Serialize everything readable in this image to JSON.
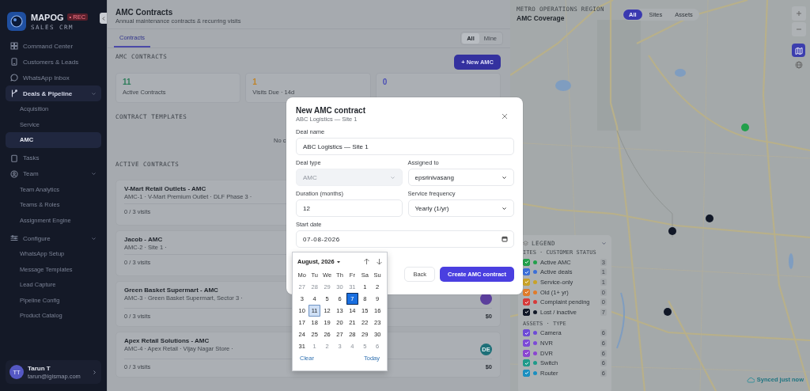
{
  "sidebar": {
    "brand": "MAPOG",
    "badge": "• REC",
    "tagline": "SALES CRM",
    "nav": [
      {
        "label": "Command Center",
        "selected": false
      },
      {
        "label": "Customers & Leads",
        "selected": false
      },
      {
        "label": "WhatsApp Inbox",
        "selected": false
      },
      {
        "label": "Deals & Pipeline",
        "selected": true,
        "expanded": true,
        "children": [
          {
            "label": "Acquisition",
            "selected": false
          },
          {
            "label": "Service",
            "selected": false
          },
          {
            "label": "AMC",
            "selected": true
          }
        ]
      },
      {
        "label": "Tasks",
        "selected": false
      },
      {
        "label": "Team",
        "selected": false,
        "expanded": true,
        "children": [
          {
            "label": "Team Analytics",
            "selected": false
          },
          {
            "label": "Teams & Roles",
            "selected": false
          },
          {
            "label": "Assignment Engine",
            "selected": false
          }
        ]
      },
      {
        "label": "Configure",
        "selected": false,
        "expanded": true,
        "children": [
          {
            "label": "WhatsApp Setup",
            "selected": false
          },
          {
            "label": "Message Templates",
            "selected": false
          },
          {
            "label": "Lead Capture",
            "selected": false
          },
          {
            "label": "Pipeline Config",
            "selected": false
          },
          {
            "label": "Product Catalog",
            "selected": false
          }
        ]
      }
    ],
    "user": {
      "initials": "TT",
      "name": "Tarun T",
      "email": "tarun@igismap.com"
    }
  },
  "page": {
    "title": "AMC Contracts",
    "subtitle": "Annual maintenance contracts & recurring visits",
    "tabs": [
      {
        "label": "Contracts",
        "selected": true
      }
    ],
    "scope": [
      {
        "label": "All",
        "selected": true
      },
      {
        "label": "Mine",
        "selected": false
      }
    ],
    "contracts_label": "AMC CONTRACTS",
    "new_button": "+ New AMC",
    "stats": [
      {
        "value": "11",
        "label": "Active Contracts",
        "color": "#2e7d5b"
      },
      {
        "value": "1",
        "label": "Visits Due · 14d",
        "color": "#c0842a"
      },
      {
        "value": "0",
        "color": "#4b4fb5"
      }
    ],
    "templates_label": "CONTRACT TEMPLATES",
    "templates_empty": "No c",
    "active_label": "ACTIVE CONTRACTS",
    "contracts": [
      {
        "title": "V-Mart Retail Outlets - AMC",
        "detail": "AMC-1 · V-Mart Premium Outlet · DLF Phase 3 ·",
        "visits": "0 / 3 visits"
      },
      {
        "title": "Jacob - AMC",
        "detail": "AMC-2 · Site 1 ·",
        "visits": "0 / 3 visits"
      },
      {
        "title": "Green Basket Supermart - AMC",
        "detail": "AMC-3 · Green Basket Supermart, Sector 3 ·",
        "visits": "0 / 3 visits",
        "amount": "$0",
        "avatar": {
          "color": "#5b3f9c"
        }
      },
      {
        "title": "Apex Retail Solutions - AMC",
        "detail": "AMC-4 · Apex Retail · Vijay Nagar Store ·",
        "visits": "0 / 3 visits",
        "amount": "$0",
        "avatar": {
          "initials": "DE",
          "color": "#1d6f78"
        }
      }
    ]
  },
  "modal": {
    "title": "New AMC contract",
    "subtitle": "ABC Logistics — Site 1",
    "rows": [
      [
        {
          "kind": "text",
          "label": "Deal name",
          "value": "ABC Logistics — Site 1",
          "disabled": false
        }
      ],
      [
        {
          "kind": "select",
          "label": "Deal type",
          "value": "AMC",
          "disabled": true
        },
        {
          "kind": "select",
          "label": "Assigned to",
          "value": "epsrinivasang",
          "disabled": false
        }
      ],
      [
        {
          "kind": "text",
          "label": "Duration (months)",
          "value": "12",
          "disabled": false
        },
        {
          "kind": "select",
          "label": "Service frequency",
          "value": "Yearly (1/yr)",
          "disabled": false
        }
      ],
      [
        {
          "kind": "date",
          "label": "Start date",
          "value": "07-08-2026",
          "disabled": false
        }
      ]
    ],
    "buttons": [
      {
        "label": "Back",
        "kind": "secondary"
      },
      {
        "label": "Create AMC contract",
        "kind": "primary"
      }
    ],
    "calendar": {
      "month": "August, 2026",
      "weekdays": [
        "Mo",
        "Tu",
        "We",
        "Th",
        "Fr",
        "Sa",
        "Su"
      ],
      "weeks": [
        [
          {
            "day": "27",
            "outside": true,
            "selected": false,
            "today": false
          },
          {
            "day": "28",
            "outside": true,
            "selected": false,
            "today": false
          },
          {
            "day": "29",
            "outside": true,
            "selected": false,
            "today": false
          },
          {
            "day": "30",
            "outside": true,
            "selected": false,
            "today": false
          },
          {
            "day": "31",
            "outside": true,
            "selected": false,
            "today": false
          },
          {
            "day": "1",
            "outside": false,
            "selected": false,
            "today": false
          },
          {
            "day": "2",
            "outside": false,
            "selected": false,
            "today": false
          }
        ],
        [
          {
            "day": "3",
            "outside": false,
            "selected": false,
            "today": false
          },
          {
            "day": "4",
            "outside": false,
            "selected": false,
            "today": false
          },
          {
            "day": "5",
            "outside": false,
            "selected": false,
            "today": false
          },
          {
            "day": "6",
            "outside": false,
            "selected": false,
            "today": false
          },
          {
            "day": "7",
            "outside": false,
            "selected": true,
            "today": false
          },
          {
            "day": "8",
            "outside": false,
            "selected": false,
            "today": false
          },
          {
            "day": "9",
            "outside": false,
            "selected": false,
            "today": false
          }
        ],
        [
          {
            "day": "10",
            "outside": false,
            "selected": false,
            "today": false
          },
          {
            "day": "11",
            "outside": false,
            "selected": false,
            "today": true
          },
          {
            "day": "12",
            "outside": false,
            "selected": false,
            "today": false
          },
          {
            "day": "13",
            "outside": false,
            "selected": false,
            "today": false
          },
          {
            "day": "14",
            "outside": false,
            "selected": false,
            "today": false
          },
          {
            "day": "15",
            "outside": false,
            "selected": false,
            "today": false
          },
          {
            "day": "16",
            "outside": false,
            "selected": false,
            "today": false
          }
        ],
        [
          {
            "day": "17",
            "outside": false,
            "selected": false,
            "today": false
          },
          {
            "day": "18",
            "outside": false,
            "selected": false,
            "today": false
          },
          {
            "day": "19",
            "outside": false,
            "selected": false,
            "today": false
          },
          {
            "day": "20",
            "outside": false,
            "selected": false,
            "today": false
          },
          {
            "day": "21",
            "outside": false,
            "selected": false,
            "today": false
          },
          {
            "day": "22",
            "outside": false,
            "selected": false,
            "today": false
          },
          {
            "day": "23",
            "outside": false,
            "selected": false,
            "today": false
          }
        ],
        [
          {
            "day": "24",
            "outside": false,
            "selected": false,
            "today": false
          },
          {
            "day": "25",
            "outside": false,
            "selected": false,
            "today": false
          },
          {
            "day": "26",
            "outside": false,
            "selected": false,
            "today": false
          },
          {
            "day": "27",
            "outside": false,
            "selected": false,
            "today": false
          },
          {
            "day": "28",
            "outside": false,
            "selected": false,
            "today": false
          },
          {
            "day": "29",
            "outside": false,
            "selected": false,
            "today": false
          },
          {
            "day": "30",
            "outside": false,
            "selected": false,
            "today": false
          }
        ],
        [
          {
            "day": "31",
            "outside": false,
            "selected": false,
            "today": false
          },
          {
            "day": "1",
            "outside": true,
            "selected": false,
            "today": false
          },
          {
            "day": "2",
            "outside": true,
            "selected": false,
            "today": false
          },
          {
            "day": "3",
            "outside": true,
            "selected": false,
            "today": false
          },
          {
            "day": "4",
            "outside": true,
            "selected": false,
            "today": false
          },
          {
            "day": "5",
            "outside": true,
            "selected": false,
            "today": false
          },
          {
            "day": "6",
            "outside": true,
            "selected": false,
            "today": false
          }
        ]
      ],
      "clear": "Clear",
      "today_button": "Today"
    }
  },
  "map": {
    "region": "METRO OPERATIONS REGION",
    "title": "AMC Coverage",
    "filters": [
      {
        "label": "All",
        "selected": true
      },
      {
        "label": "Sites",
        "selected": false
      },
      {
        "label": "Assets",
        "selected": false
      }
    ],
    "markers": [
      {
        "color": "#22a04b"
      },
      {
        "color": "#111827"
      },
      {
        "color": "#111827"
      },
      {
        "color": "#111827"
      }
    ],
    "legend": {
      "title": "LEGEND",
      "expanded": true,
      "groups": [
        {
          "title": "ITES · CUSTOMER STATUS",
          "items": [
            {
              "label": "Active AMC",
              "count": "3",
              "checked": true,
              "color": "#22a04b"
            },
            {
              "label": "Active deals",
              "count": "1",
              "checked": true,
              "color": "#3b6fd8"
            },
            {
              "label": "Service-only",
              "count": "1",
              "checked": true,
              "color": "#c9a227"
            },
            {
              "label": "Old (1+ yr)",
              "count": "0",
              "checked": true,
              "color": "#e07b2a"
            },
            {
              "label": "Complaint pending",
              "count": "0",
              "checked": true,
              "color": "#d63a3a"
            },
            {
              "label": "Lost / inactive",
              "count": "7",
              "checked": true,
              "color": "#111827"
            }
          ]
        },
        {
          "title": "ASSETS · TYPE",
          "items": [
            {
              "label": "Camera",
              "count": "6",
              "checked": true,
              "color": "#6d4ad6"
            },
            {
              "label": "NVR",
              "count": "6",
              "checked": true,
              "color": "#7c4ad6"
            },
            {
              "label": "DVR",
              "count": "6",
              "checked": true,
              "color": "#8b45d0"
            },
            {
              "label": "Switch",
              "count": "6",
              "checked": true,
              "color": "#1f9a8a"
            },
            {
              "label": "Router",
              "count": "6",
              "checked": true,
              "color": "#1a8fc0"
            }
          ]
        }
      ]
    },
    "sync": "Synced just now"
  }
}
